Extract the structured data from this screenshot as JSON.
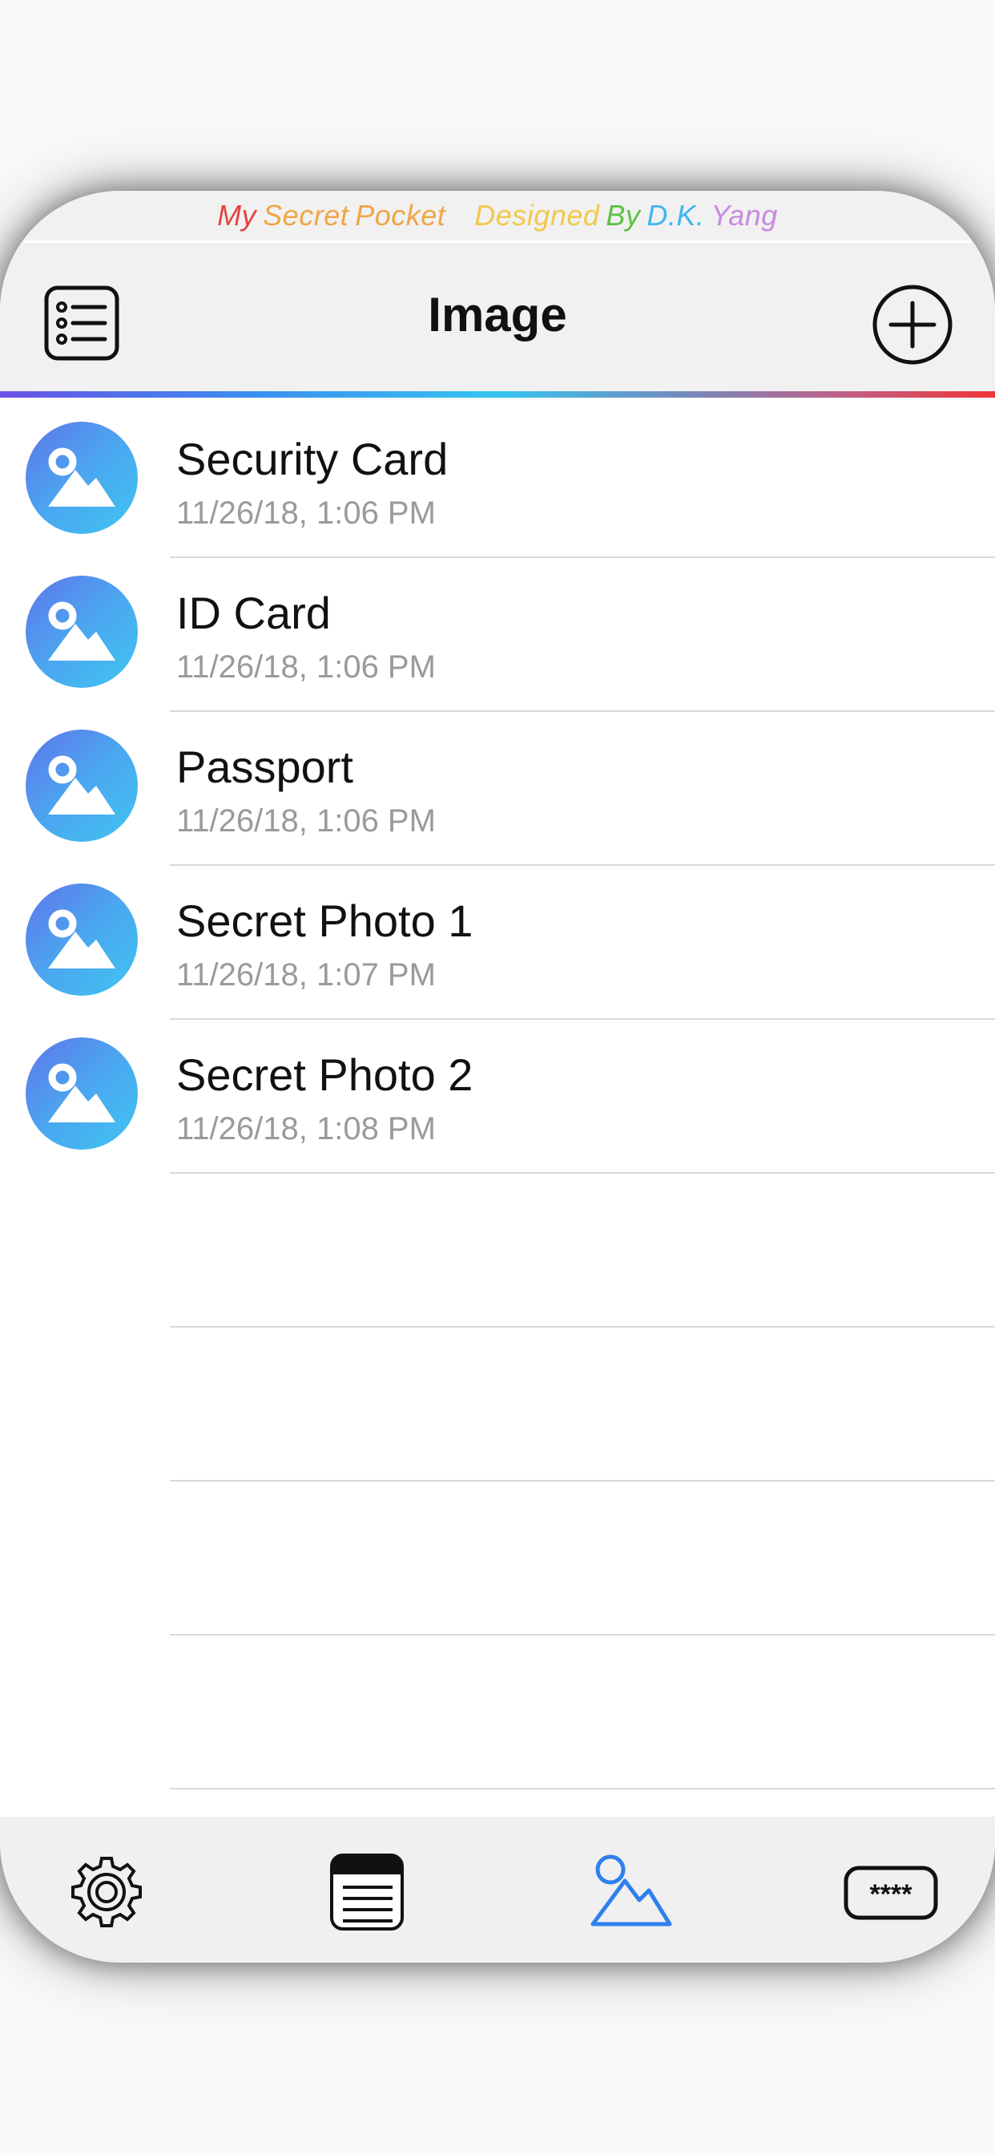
{
  "credit": {
    "words": [
      "My",
      "Secret",
      "Pocket",
      "Designed",
      "By",
      "D.K.",
      "Yang"
    ],
    "colors": [
      "#e5433f",
      "#f0a548",
      "#f0a548",
      "#f2c84c",
      "#5cc241",
      "#3fb6ee",
      "#c78ae0"
    ]
  },
  "header": {
    "title": "Image",
    "left_icon": "list-icon",
    "right_icon": "plus-circle-icon"
  },
  "items": [
    {
      "title": "Security Card",
      "date": "11/26/18, 1:06 PM",
      "icon": "image-icon"
    },
    {
      "title": "ID Card",
      "date": "11/26/18, 1:06 PM",
      "icon": "image-icon"
    },
    {
      "title": "Passport",
      "date": "11/26/18, 1:06 PM",
      "icon": "image-icon"
    },
    {
      "title": "Secret Photo 1",
      "date": "11/26/18, 1:07 PM",
      "icon": "image-icon"
    },
    {
      "title": "Secret Photo 2",
      "date": "11/26/18, 1:08 PM",
      "icon": "image-icon"
    }
  ],
  "tabbar": {
    "tabs": [
      {
        "name": "settings",
        "icon": "gear-icon",
        "active": false
      },
      {
        "name": "notes",
        "icon": "notepad-icon",
        "active": false
      },
      {
        "name": "image",
        "icon": "image-icon",
        "active": true
      },
      {
        "name": "password",
        "icon": "password-icon",
        "active": false
      }
    ],
    "active_color": "#2f80ee",
    "inactive_color": "#111111"
  },
  "colors": {
    "accent_gradient": [
      "#6a52e6",
      "#35c4f0",
      "#f03535"
    ],
    "icon_gradient": [
      "#5f74ea",
      "#3fc4f0"
    ]
  }
}
